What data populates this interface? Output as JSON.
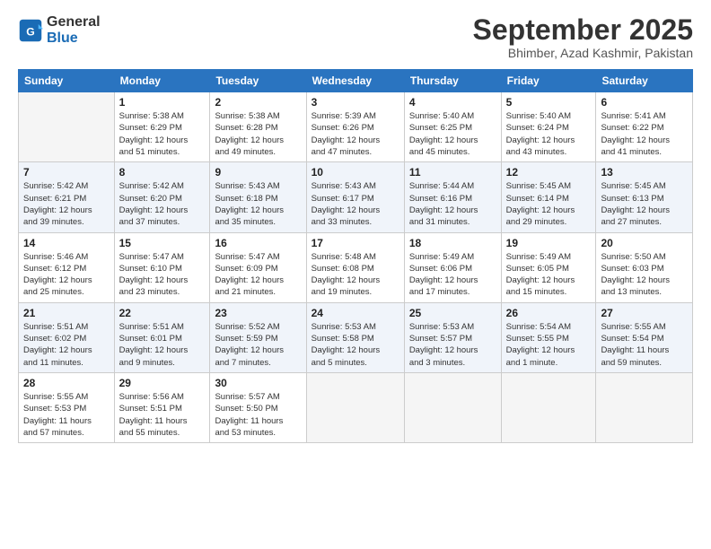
{
  "header": {
    "logo_line1": "General",
    "logo_line2": "Blue",
    "month": "September 2025",
    "location": "Bhimber, Azad Kashmir, Pakistan"
  },
  "weekdays": [
    "Sunday",
    "Monday",
    "Tuesday",
    "Wednesday",
    "Thursday",
    "Friday",
    "Saturday"
  ],
  "weeks": [
    [
      {
        "day": "",
        "info": ""
      },
      {
        "day": "1",
        "info": "Sunrise: 5:38 AM\nSunset: 6:29 PM\nDaylight: 12 hours\nand 51 minutes."
      },
      {
        "day": "2",
        "info": "Sunrise: 5:38 AM\nSunset: 6:28 PM\nDaylight: 12 hours\nand 49 minutes."
      },
      {
        "day": "3",
        "info": "Sunrise: 5:39 AM\nSunset: 6:26 PM\nDaylight: 12 hours\nand 47 minutes."
      },
      {
        "day": "4",
        "info": "Sunrise: 5:40 AM\nSunset: 6:25 PM\nDaylight: 12 hours\nand 45 minutes."
      },
      {
        "day": "5",
        "info": "Sunrise: 5:40 AM\nSunset: 6:24 PM\nDaylight: 12 hours\nand 43 minutes."
      },
      {
        "day": "6",
        "info": "Sunrise: 5:41 AM\nSunset: 6:22 PM\nDaylight: 12 hours\nand 41 minutes."
      }
    ],
    [
      {
        "day": "7",
        "info": "Sunrise: 5:42 AM\nSunset: 6:21 PM\nDaylight: 12 hours\nand 39 minutes."
      },
      {
        "day": "8",
        "info": "Sunrise: 5:42 AM\nSunset: 6:20 PM\nDaylight: 12 hours\nand 37 minutes."
      },
      {
        "day": "9",
        "info": "Sunrise: 5:43 AM\nSunset: 6:18 PM\nDaylight: 12 hours\nand 35 minutes."
      },
      {
        "day": "10",
        "info": "Sunrise: 5:43 AM\nSunset: 6:17 PM\nDaylight: 12 hours\nand 33 minutes."
      },
      {
        "day": "11",
        "info": "Sunrise: 5:44 AM\nSunset: 6:16 PM\nDaylight: 12 hours\nand 31 minutes."
      },
      {
        "day": "12",
        "info": "Sunrise: 5:45 AM\nSunset: 6:14 PM\nDaylight: 12 hours\nand 29 minutes."
      },
      {
        "day": "13",
        "info": "Sunrise: 5:45 AM\nSunset: 6:13 PM\nDaylight: 12 hours\nand 27 minutes."
      }
    ],
    [
      {
        "day": "14",
        "info": "Sunrise: 5:46 AM\nSunset: 6:12 PM\nDaylight: 12 hours\nand 25 minutes."
      },
      {
        "day": "15",
        "info": "Sunrise: 5:47 AM\nSunset: 6:10 PM\nDaylight: 12 hours\nand 23 minutes."
      },
      {
        "day": "16",
        "info": "Sunrise: 5:47 AM\nSunset: 6:09 PM\nDaylight: 12 hours\nand 21 minutes."
      },
      {
        "day": "17",
        "info": "Sunrise: 5:48 AM\nSunset: 6:08 PM\nDaylight: 12 hours\nand 19 minutes."
      },
      {
        "day": "18",
        "info": "Sunrise: 5:49 AM\nSunset: 6:06 PM\nDaylight: 12 hours\nand 17 minutes."
      },
      {
        "day": "19",
        "info": "Sunrise: 5:49 AM\nSunset: 6:05 PM\nDaylight: 12 hours\nand 15 minutes."
      },
      {
        "day": "20",
        "info": "Sunrise: 5:50 AM\nSunset: 6:03 PM\nDaylight: 12 hours\nand 13 minutes."
      }
    ],
    [
      {
        "day": "21",
        "info": "Sunrise: 5:51 AM\nSunset: 6:02 PM\nDaylight: 12 hours\nand 11 minutes."
      },
      {
        "day": "22",
        "info": "Sunrise: 5:51 AM\nSunset: 6:01 PM\nDaylight: 12 hours\nand 9 minutes."
      },
      {
        "day": "23",
        "info": "Sunrise: 5:52 AM\nSunset: 5:59 PM\nDaylight: 12 hours\nand 7 minutes."
      },
      {
        "day": "24",
        "info": "Sunrise: 5:53 AM\nSunset: 5:58 PM\nDaylight: 12 hours\nand 5 minutes."
      },
      {
        "day": "25",
        "info": "Sunrise: 5:53 AM\nSunset: 5:57 PM\nDaylight: 12 hours\nand 3 minutes."
      },
      {
        "day": "26",
        "info": "Sunrise: 5:54 AM\nSunset: 5:55 PM\nDaylight: 12 hours\nand 1 minute."
      },
      {
        "day": "27",
        "info": "Sunrise: 5:55 AM\nSunset: 5:54 PM\nDaylight: 11 hours\nand 59 minutes."
      }
    ],
    [
      {
        "day": "28",
        "info": "Sunrise: 5:55 AM\nSunset: 5:53 PM\nDaylight: 11 hours\nand 57 minutes."
      },
      {
        "day": "29",
        "info": "Sunrise: 5:56 AM\nSunset: 5:51 PM\nDaylight: 11 hours\nand 55 minutes."
      },
      {
        "day": "30",
        "info": "Sunrise: 5:57 AM\nSunset: 5:50 PM\nDaylight: 11 hours\nand 53 minutes."
      },
      {
        "day": "",
        "info": ""
      },
      {
        "day": "",
        "info": ""
      },
      {
        "day": "",
        "info": ""
      },
      {
        "day": "",
        "info": ""
      }
    ]
  ]
}
